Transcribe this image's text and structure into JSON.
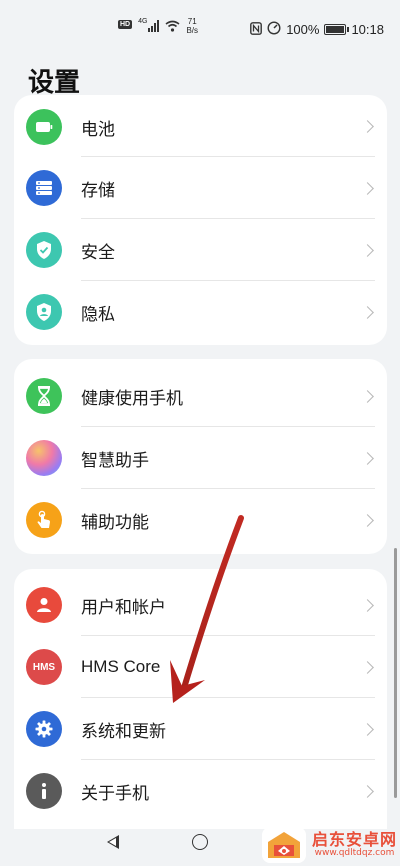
{
  "status_bar": {
    "hd_badge": "HD",
    "signal_badge": "4G",
    "speed_value": "71",
    "speed_unit": "B/s",
    "battery_text": "100%",
    "time": "10:18"
  },
  "page": {
    "title": "设置"
  },
  "cards": [
    {
      "items": [
        {
          "label": "电池",
          "icon": "battery-icon",
          "color": "#3cc25c"
        },
        {
          "label": "存储",
          "icon": "storage-icon",
          "color": "#2f6ad6"
        },
        {
          "label": "安全",
          "icon": "shield-check-icon",
          "color": "#3dc7b0"
        },
        {
          "label": "隐私",
          "icon": "privacy-icon",
          "color": "#3dc7b0"
        }
      ]
    },
    {
      "items": [
        {
          "label": "健康使用手机",
          "icon": "hourglass-icon",
          "color": "#3ec35a"
        },
        {
          "label": "智慧助手",
          "icon": "assistant-icon",
          "color": "#b78af0"
        },
        {
          "label": "辅助功能",
          "icon": "hand-icon",
          "color": "#f6a218"
        }
      ]
    },
    {
      "items": [
        {
          "label": "用户和帐户",
          "icon": "user-icon",
          "color": "#e84a3c"
        },
        {
          "label": "HMS Core",
          "icon": "hms-icon",
          "color": "#dd4a4a"
        },
        {
          "label": "系统和更新",
          "icon": "settings-gear-icon",
          "color": "#2f6ad6"
        },
        {
          "label": "关于手机",
          "icon": "info-icon",
          "color": "#5a5a5a"
        }
      ]
    }
  ],
  "icons": {
    "hms_text": "HMS"
  },
  "watermark": {
    "title": "启东安卓网",
    "url": "www.qdltdqz.com"
  },
  "colors": {
    "background": "#f1f3f5",
    "card": "#ffffff",
    "annotation_arrow": "#b5211c"
  }
}
